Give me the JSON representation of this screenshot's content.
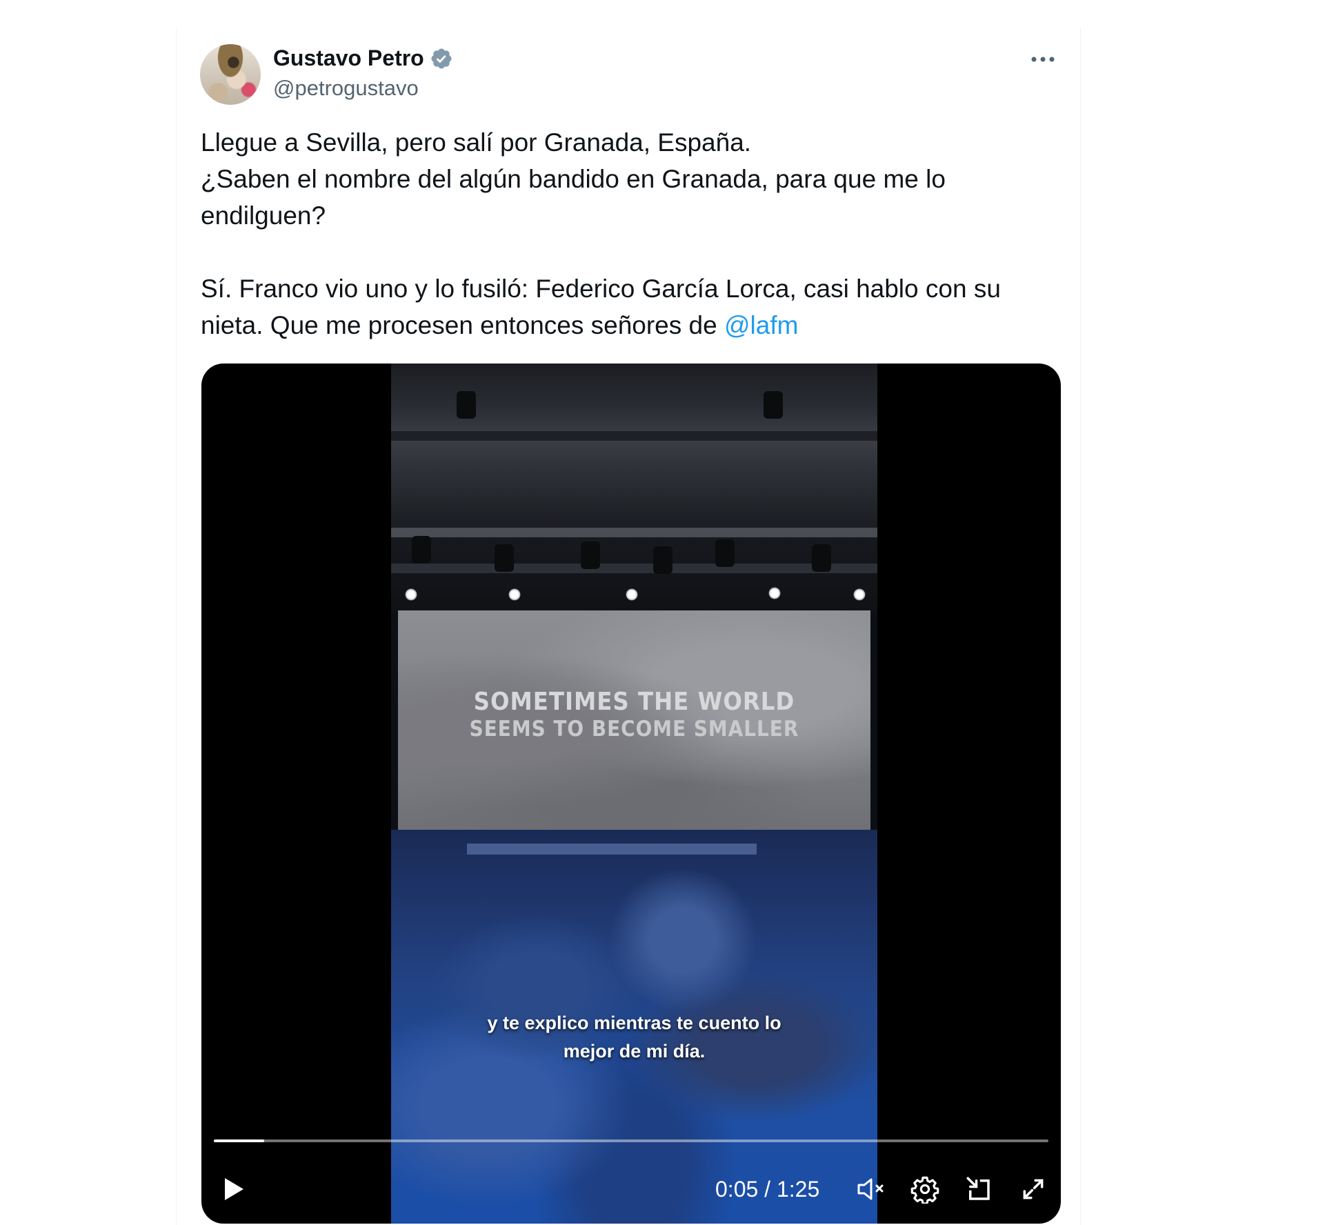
{
  "author": {
    "name": "Gustavo Petro",
    "handle": "@petrogustavo",
    "verified": true
  },
  "tweet": {
    "line1": "Llegue a Sevilla, pero salí por Granada, España.",
    "line2": "¿Saben el nombre del algún bandido en Granada, para que me lo endilguen?",
    "line3": "Sí. Franco vio uno y lo fusiló: Federico García Lorca, casi hablo con su nieta. Que me procesen entonces señores de",
    "mention": "@lafm"
  },
  "video": {
    "screen_text_line1": "SOMETIMES THE WORLD",
    "screen_text_line2": "SEEMS TO BECOME SMALLER",
    "subtitle_line1": "y te explico mientras te cuento lo",
    "subtitle_line2": "mejor de mi día.",
    "current_time": "0:05",
    "duration": "1:25",
    "time_display": "0:05 / 1:25",
    "progress_fraction": 0.06
  },
  "icons": {
    "more": "more-icon",
    "verified": "verified-badge-icon",
    "play": "play-icon",
    "mute": "volume-muted-icon",
    "settings": "settings-gear-icon",
    "pip": "picture-in-picture-icon",
    "fullscreen": "fullscreen-icon"
  },
  "colors": {
    "link": "#1d9bf0",
    "text": "#0f1419",
    "secondary": "#536471",
    "verified": "#829aab"
  }
}
